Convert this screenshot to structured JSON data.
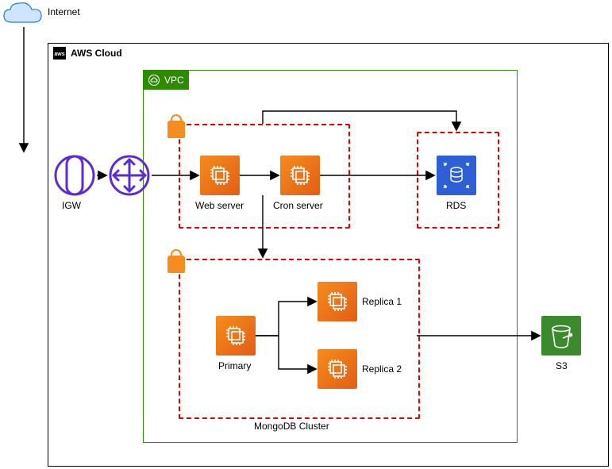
{
  "labels": {
    "internet": "Internet",
    "aws_cloud": "AWS Cloud",
    "vpc": "VPC",
    "igw": "IGW",
    "web_server": "Web server",
    "cron_server": "Cron server",
    "rds": "RDS",
    "primary": "Primary",
    "replica1": "Replica 1",
    "replica2": "Replica 2",
    "mongo_cluster": "MongoDB Cluster",
    "s3": "S3"
  },
  "colors": {
    "aws_border": "#000000",
    "vpc_green": "#2e8b00",
    "sg_red": "#e60000",
    "ec2_orange": "#ed7211",
    "rds_blue": "#2f5fd6",
    "s3_green": "#3b8b2e",
    "igw_purple": "#5b2bd6",
    "cloud_blue": "#1e7fe0"
  }
}
